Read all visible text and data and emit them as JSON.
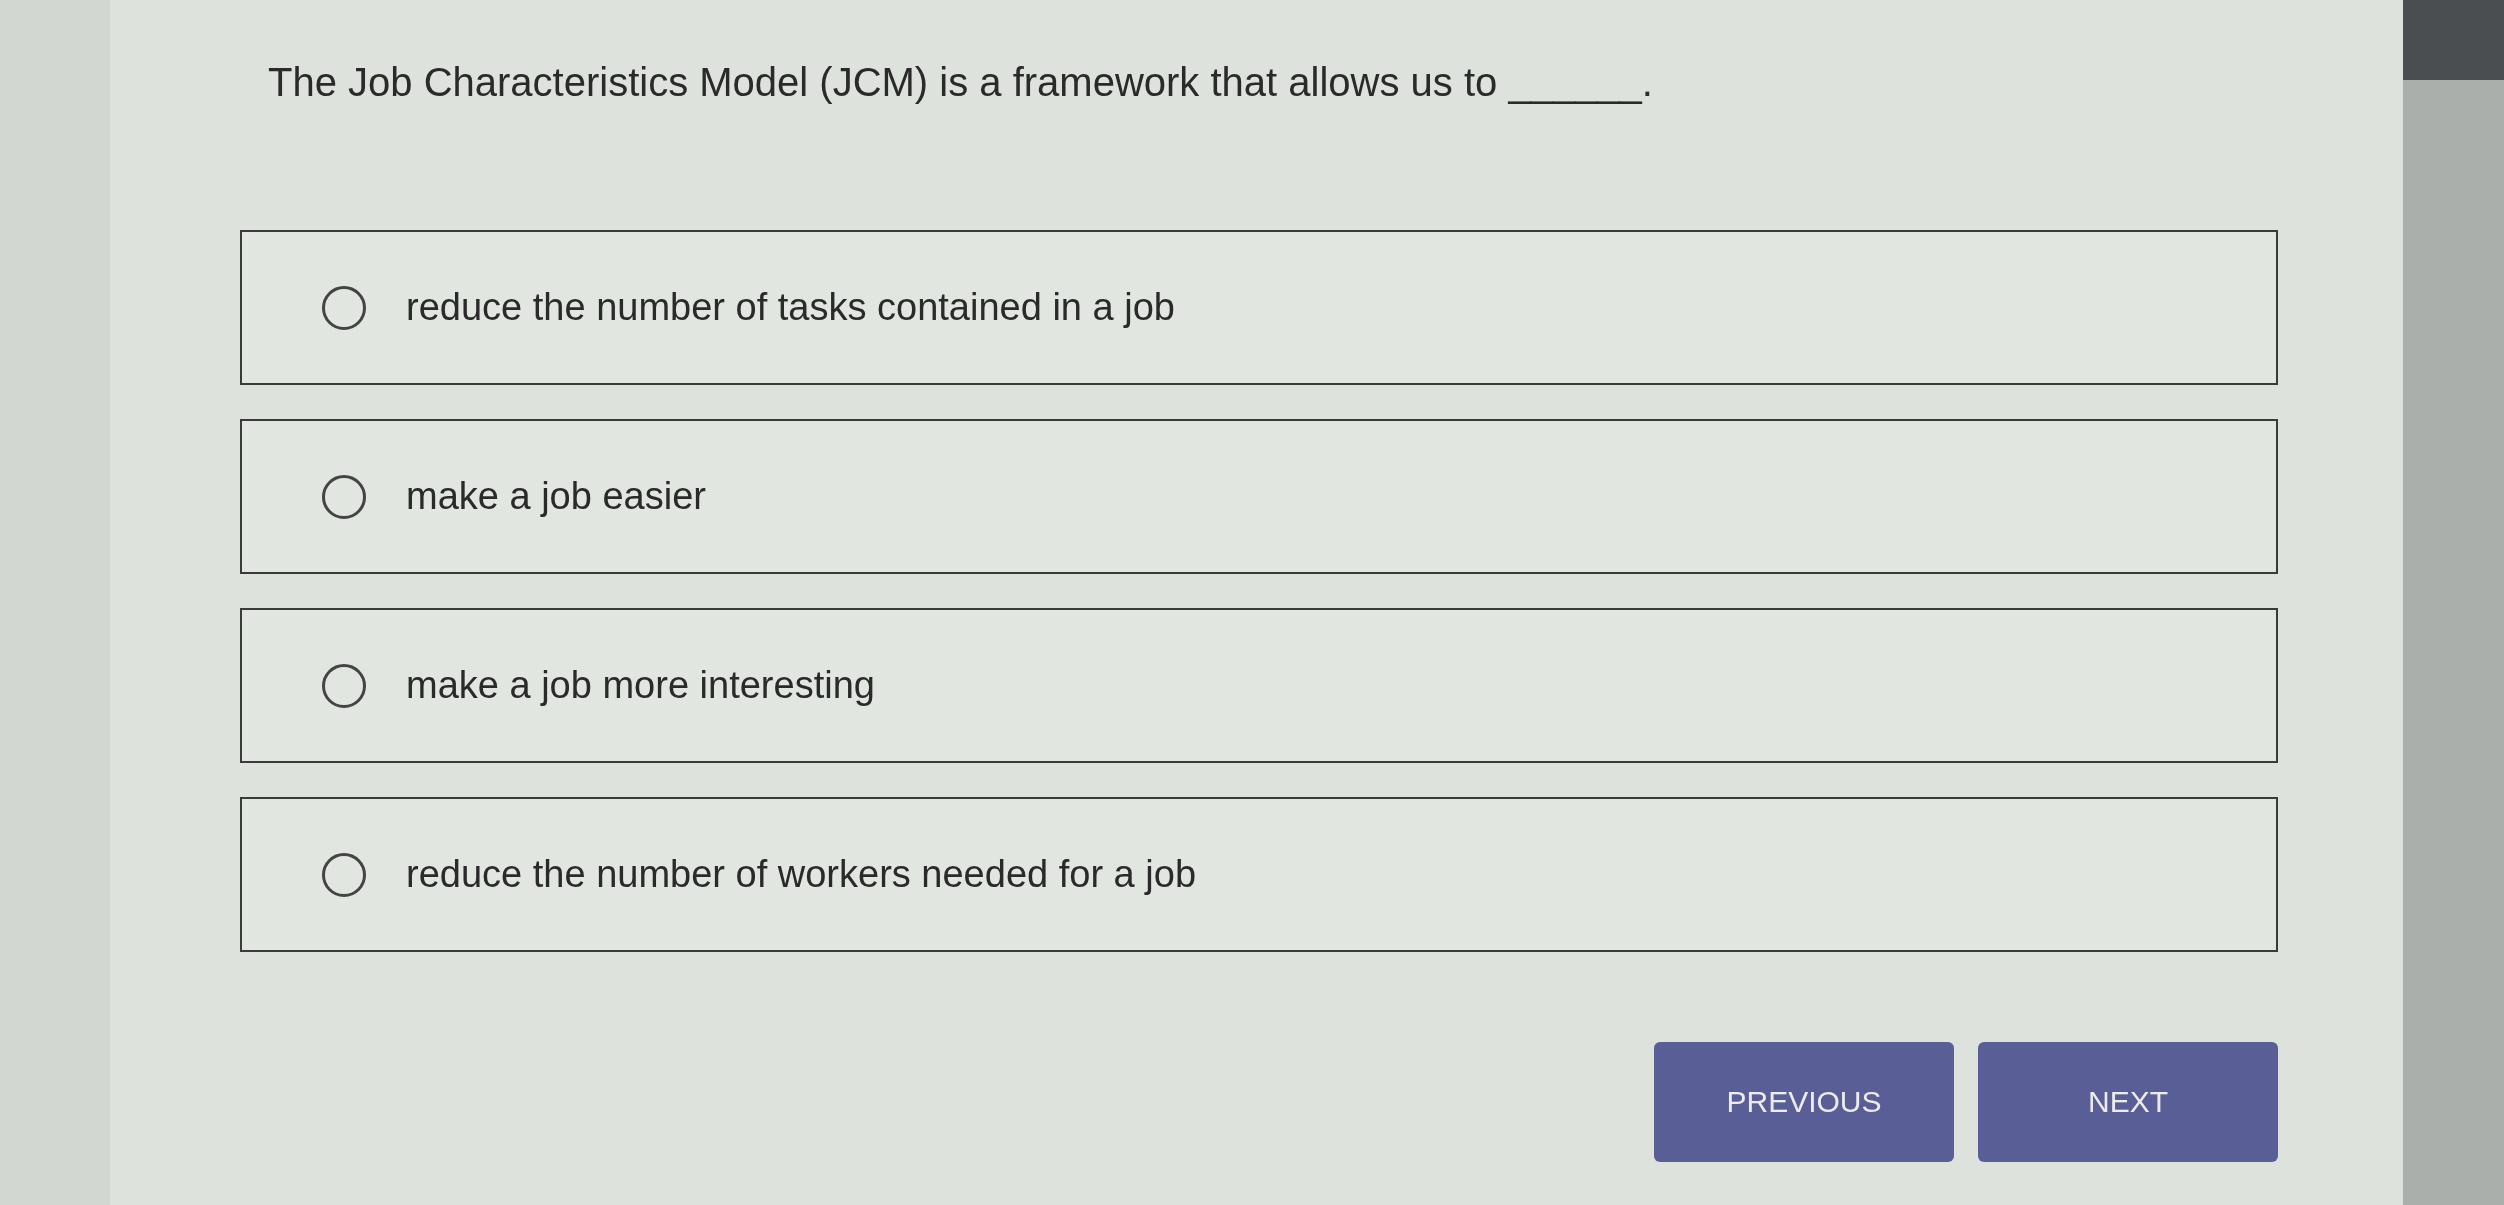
{
  "question": {
    "text": "The Job Characteristics Model (JCM) is a framework that allows us to ______."
  },
  "options": [
    {
      "label": "reduce the number of tasks contained in a job",
      "selected": false
    },
    {
      "label": "make a job easier",
      "selected": false
    },
    {
      "label": "make a job more interesting",
      "selected": false
    },
    {
      "label": "reduce the number of workers needed for a job",
      "selected": false
    }
  ],
  "buttons": [
    {
      "label": "PREVIOUS"
    },
    {
      "label": "NEXT"
    }
  ]
}
